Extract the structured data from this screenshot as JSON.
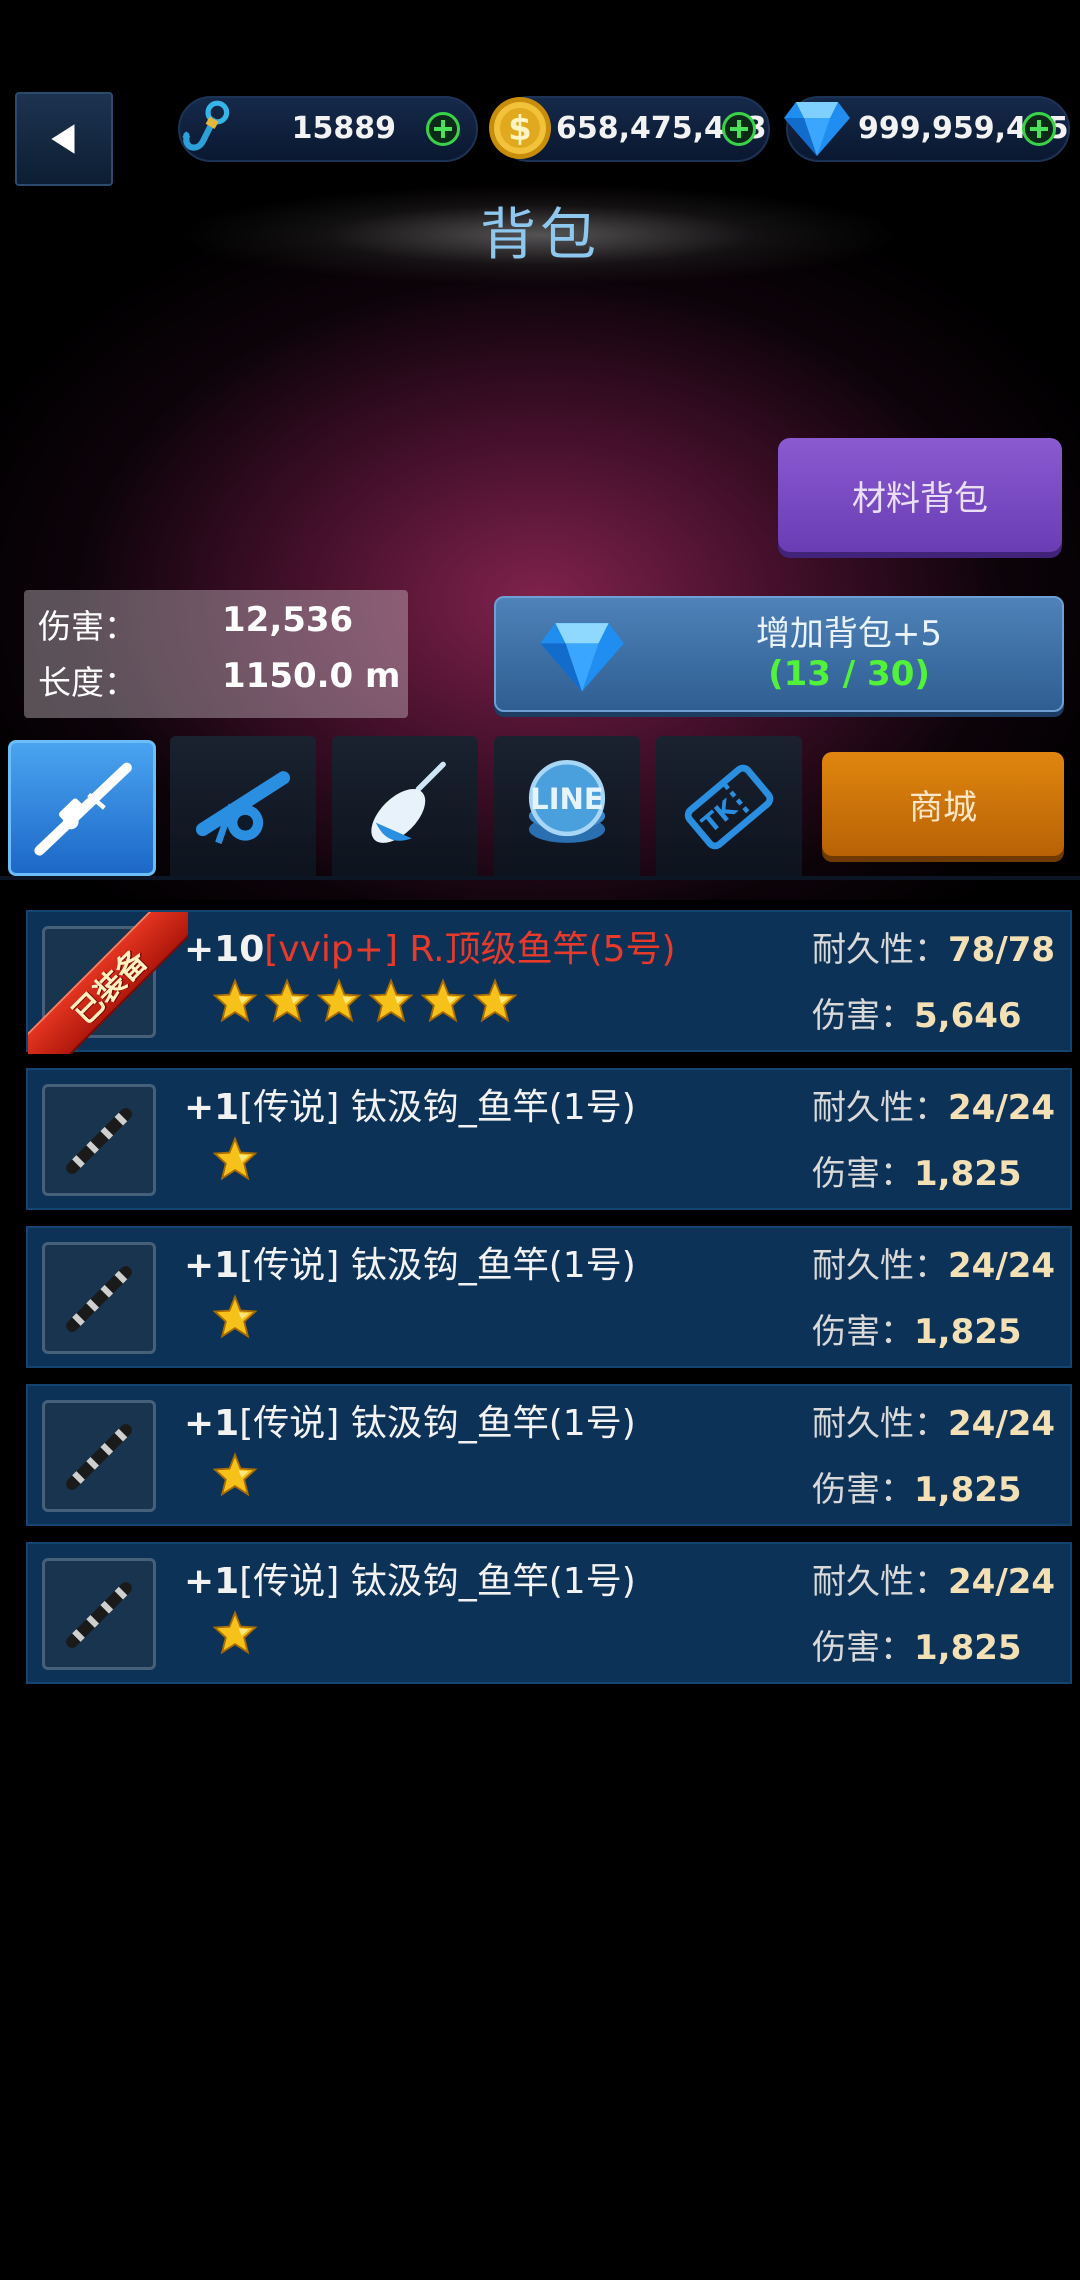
{
  "header": {
    "title": "背包",
    "back_icon": "back-arrow-icon"
  },
  "currencies": {
    "hooks": {
      "value": "15889",
      "icon": "hook-icon"
    },
    "gold": {
      "value": "658,475,463",
      "icon": "gold-coin-icon"
    },
    "gems": {
      "value": "999,959,415",
      "icon": "diamond-icon"
    }
  },
  "material_bag_label": "材料背包",
  "stats": {
    "damage_label": "伤害：",
    "damage_value": "12,536",
    "length_label": "长度：",
    "length_value": "1150.0 m"
  },
  "expand": {
    "label": "增加背包+5",
    "count": "(13 / 30)"
  },
  "tabs": [
    {
      "name": "rod",
      "icon": "fishing-rod-icon",
      "active": true
    },
    {
      "name": "reel",
      "icon": "reel-icon",
      "active": false
    },
    {
      "name": "float",
      "icon": "float-icon",
      "active": false
    },
    {
      "name": "line",
      "icon": "line-spool-icon",
      "active": false
    },
    {
      "name": "ticket",
      "icon": "ticket-icon",
      "active": false
    }
  ],
  "shop_label": "商城",
  "items": [
    {
      "level": "+10",
      "name_red": "[vvip+] R.顶级鱼竿(5号)",
      "name_plain": "",
      "stars": 6,
      "durability_label": "耐久性：",
      "durability": "78/78",
      "damage_label": "伤害：",
      "damage": "5,646",
      "equipped": true,
      "equipped_label": "已装备"
    },
    {
      "level": "+1",
      "name_red": "",
      "name_plain": "[传说] 钛汲钩_鱼竿(1号)",
      "stars": 1,
      "durability_label": "耐久性：",
      "durability": "24/24",
      "damage_label": "伤害：",
      "damage": "1,825",
      "equipped": false
    },
    {
      "level": "+1",
      "name_red": "",
      "name_plain": "[传说] 钛汲钩_鱼竿(1号)",
      "stars": 1,
      "durability_label": "耐久性：",
      "durability": "24/24",
      "damage_label": "伤害：",
      "damage": "1,825",
      "equipped": false
    },
    {
      "level": "+1",
      "name_red": "",
      "name_plain": "[传说] 钛汲钩_鱼竿(1号)",
      "stars": 1,
      "durability_label": "耐久性：",
      "durability": "24/24",
      "damage_label": "伤害：",
      "damage": "1,825",
      "equipped": false
    },
    {
      "level": "+1",
      "name_red": "",
      "name_plain": "[传说] 钛汲钩_鱼竿(1号)",
      "stars": 1,
      "durability_label": "耐久性：",
      "durability": "24/24",
      "damage_label": "伤害：",
      "damage": "1,825",
      "equipped": false
    }
  ]
}
